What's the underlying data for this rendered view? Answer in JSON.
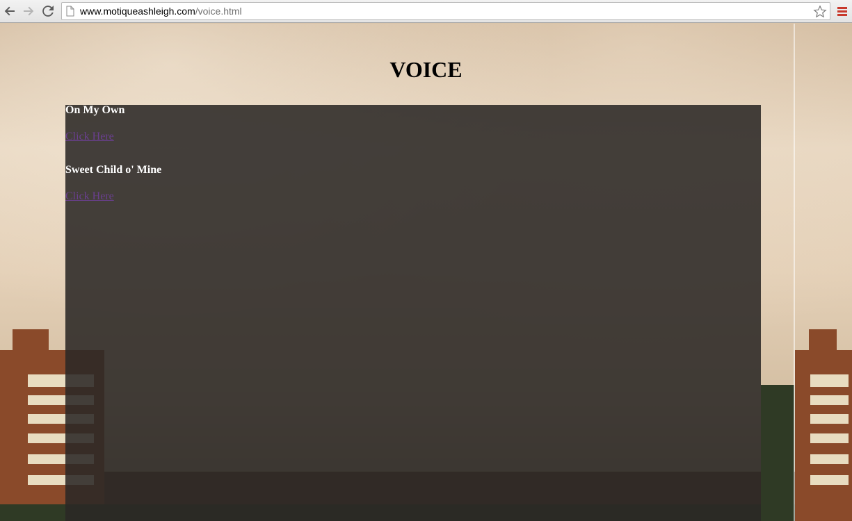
{
  "browser": {
    "url_host": "www.motiqueashleigh.com",
    "url_path": "/voice.html",
    "icons": [
      "back-arrow-icon",
      "forward-arrow-icon",
      "reload-icon",
      "page-icon",
      "star-icon",
      "menu-icon"
    ]
  },
  "page": {
    "title": "VOICE",
    "songs": [
      {
        "title": "On My Own",
        "link": "Click Here"
      },
      {
        "title": "Sweet Child o' Mine",
        "link": "Click Here"
      }
    ]
  },
  "colors": {
    "panel": "#2b2825",
    "link_visited": "#6a3f8f",
    "song_title": "#ffffff"
  }
}
